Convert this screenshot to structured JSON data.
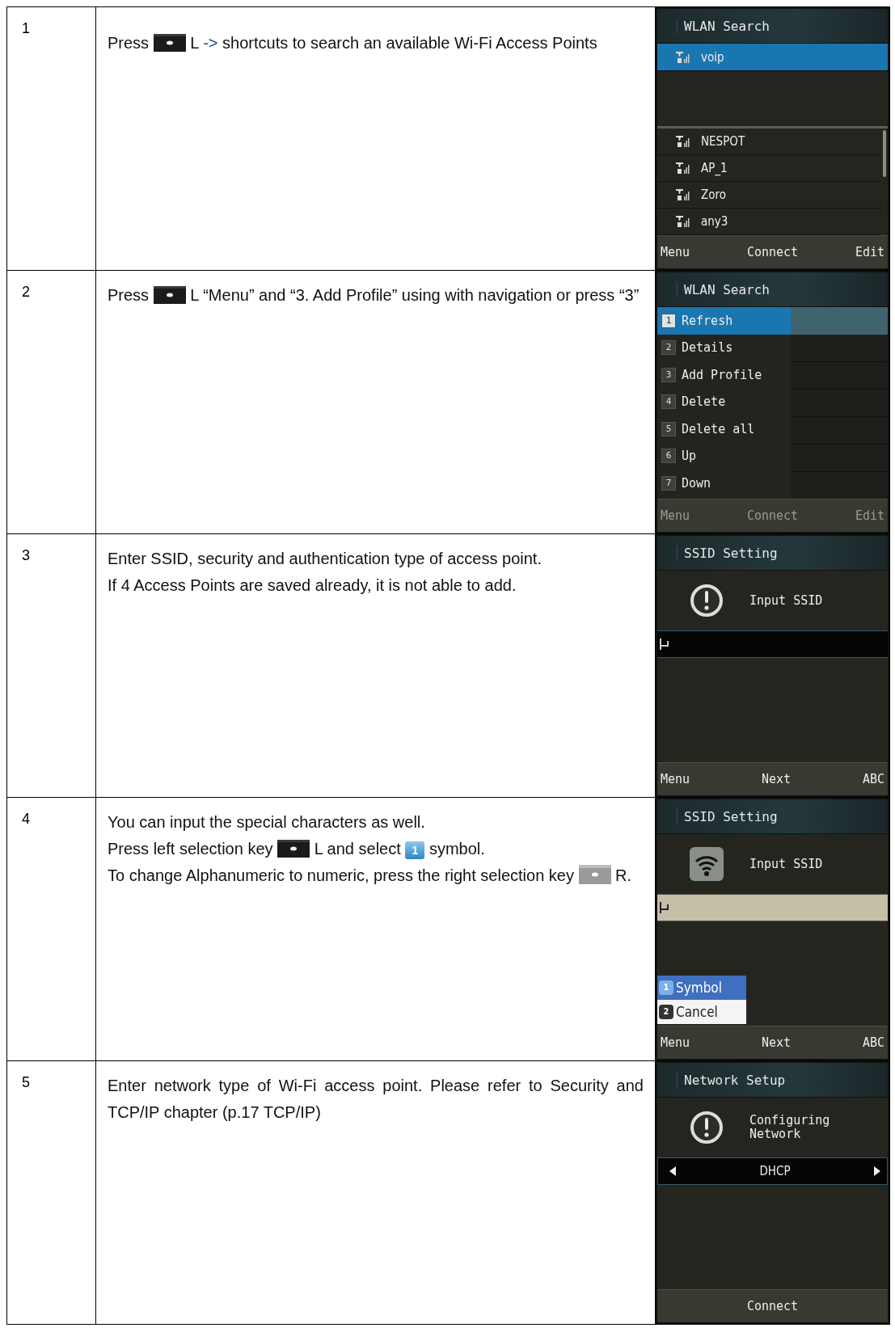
{
  "steps": [
    {
      "number": "1",
      "paragraphs": [
        [
          {
            "kind": "text",
            "text": "Press"
          },
          {
            "kind": "dark_key"
          },
          {
            "kind": "text",
            "text": "L"
          },
          {
            "kind": "arrow",
            "text": "->"
          },
          {
            "kind": "text",
            "text": "shortcuts to search an available Wi-Fi Access Points"
          }
        ]
      ],
      "screen": {
        "kind": "list",
        "title": "WLAN Search",
        "profiles": [
          {
            "name": "voip",
            "selected": true
          }
        ],
        "networks": [
          {
            "name": "NESPOT",
            "selected": false
          },
          {
            "name": "AP_1",
            "selected": false
          },
          {
            "name": "Zoro",
            "selected": false
          },
          {
            "name": "any3",
            "selected": false
          }
        ],
        "softkeys": [
          {
            "label": "Menu",
            "disabled": false
          },
          {
            "label": "Connect",
            "disabled": false
          },
          {
            "label": "Edit",
            "disabled": false
          }
        ]
      }
    },
    {
      "number": "2",
      "paragraphs": [
        [
          {
            "kind": "text",
            "text": "Press"
          },
          {
            "kind": "dark_key"
          },
          {
            "kind": "text",
            "text": "L “Menu” and “3. Add Profile” using with navigation or press “3”"
          }
        ]
      ],
      "screen": {
        "kind": "menu",
        "title": "WLAN Search",
        "menu": [
          {
            "number": "1",
            "label": "Refresh",
            "selected": true
          },
          {
            "number": "2",
            "label": "Details",
            "selected": false
          },
          {
            "number": "3",
            "label": "Add Profile",
            "selected": false
          },
          {
            "number": "4",
            "label": "Delete",
            "selected": false
          },
          {
            "number": "5",
            "label": "Delete all",
            "selected": false
          },
          {
            "number": "6",
            "label": "Up",
            "selected": false
          },
          {
            "number": "7",
            "label": "Down",
            "selected": false
          }
        ],
        "softkeys": [
          {
            "label": "Menu",
            "disabled": true
          },
          {
            "label": "Connect",
            "disabled": true
          },
          {
            "label": "Edit",
            "disabled": true
          }
        ]
      }
    },
    {
      "number": "3",
      "paragraphs": [
        [
          {
            "kind": "text",
            "text": "Enter SSID, security and authentication type of access point."
          }
        ],
        [
          {
            "kind": "text",
            "text": "If 4 Access Points are saved already, it is not able to add."
          }
        ]
      ],
      "screen": {
        "kind": "input",
        "title": "SSID Setting",
        "message": "Input SSID",
        "softkeys": [
          {
            "label": "Menu",
            "disabled": false
          },
          {
            "label": "Next",
            "disabled": false
          },
          {
            "label": "ABC",
            "disabled": false
          }
        ]
      }
    },
    {
      "number": "4",
      "paragraphs": [
        [
          {
            "kind": "text",
            "text": "You can input the special characters as well."
          }
        ],
        [
          {
            "kind": "text",
            "text": "Press left selection key"
          },
          {
            "kind": "dark_key"
          },
          {
            "kind": "text",
            "text": "L and select"
          },
          {
            "kind": "symbol_key",
            "text": "1"
          },
          {
            "kind": "text",
            "text": "symbol."
          }
        ],
        [
          {
            "kind": "text",
            "text": "To change Alphanumeric to numeric, press the right selection key"
          },
          {
            "kind": "grey_key"
          },
          {
            "kind": "text",
            "text": "R."
          }
        ]
      ],
      "screen": {
        "kind": "symbol_input",
        "title": "SSID Setting",
        "message": "Input SSID",
        "popup": [
          {
            "number": "1",
            "label": "Symbol",
            "selected": true
          },
          {
            "number": "2",
            "label": "Cancel",
            "selected": false
          }
        ],
        "softkeys": [
          {
            "label": "Menu",
            "disabled": false
          },
          {
            "label": "Next",
            "disabled": false
          },
          {
            "label": "ABC",
            "disabled": false
          }
        ]
      }
    },
    {
      "number": "5",
      "paragraphs": [
        [
          {
            "kind": "text",
            "text": "Enter network  type of Wi-Fi access point. Please refer to Security and TCP/IP chapter (p.17 TCP/IP)"
          }
        ]
      ],
      "screen": {
        "kind": "selector",
        "title": "Network Setup",
        "message": "Configuring Network",
        "selector": "DHCP",
        "softkeys": [
          {
            "label": "Connect",
            "disabled": false
          }
        ]
      }
    }
  ]
}
